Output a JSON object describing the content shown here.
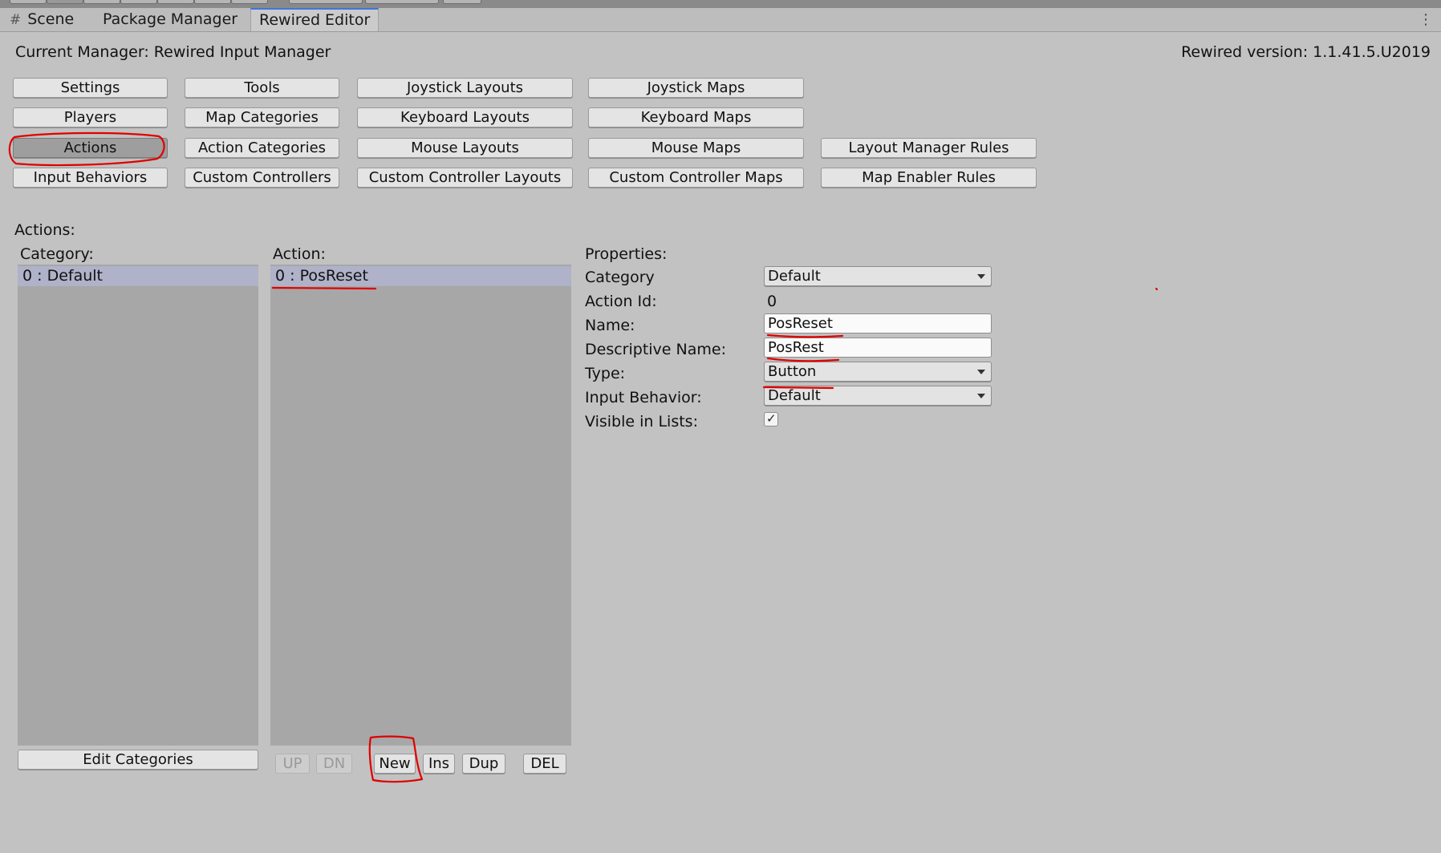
{
  "tabs": [
    {
      "label": "Scene",
      "icon": "grid-hash-icon"
    },
    {
      "label": "Package Manager"
    },
    {
      "label": "Rewired Editor",
      "active": true
    }
  ],
  "header": {
    "current_manager": "Current Manager: Rewired Input Manager",
    "version": "Rewired version: 1.1.41.5.U2019"
  },
  "nav_buttons": {
    "settings": "Settings",
    "tools": "Tools",
    "joystick_layouts": "Joystick Layouts",
    "joystick_maps": "Joystick Maps",
    "players": "Players",
    "map_categories": "Map Categories",
    "keyboard_layouts": "Keyboard Layouts",
    "keyboard_maps": "Keyboard Maps",
    "actions": "Actions",
    "action_categories": "Action Categories",
    "mouse_layouts": "Mouse Layouts",
    "mouse_maps": "Mouse Maps",
    "layout_manager_rules": "Layout Manager Rules",
    "input_behaviors": "Input Behaviors",
    "custom_controllers": "Custom Controllers",
    "custom_controller_layouts": "Custom Controller Layouts",
    "custom_controller_maps": "Custom Controller Maps",
    "map_enabler_rules": "Map Enabler Rules",
    "active": "actions"
  },
  "section_title": "Actions:",
  "category_panel": {
    "heading": "Category:",
    "items": [
      "0 : Default"
    ],
    "edit_button": "Edit Categories"
  },
  "action_panel": {
    "heading": "Action:",
    "items": [
      "0 : PosReset"
    ],
    "buttons": {
      "up": "UP",
      "dn": "DN",
      "new": "New",
      "ins": "Ins",
      "dup": "Dup",
      "del": "DEL"
    }
  },
  "properties": {
    "heading": "Properties:",
    "category_label": "Category",
    "category_value": "Default",
    "action_id_label": "Action Id:",
    "action_id_value": "0",
    "name_label": "Name:",
    "name_value": "PosReset",
    "descriptive_name_label": "Descriptive Name:",
    "descriptive_name_value": "PosRest",
    "type_label": "Type:",
    "type_value": "Button",
    "input_behavior_label": "Input Behavior:",
    "input_behavior_value": "Default",
    "visible_in_lists_label": "Visible in Lists:",
    "visible_in_lists_checked": true
  },
  "annotation_color": "#e00000"
}
